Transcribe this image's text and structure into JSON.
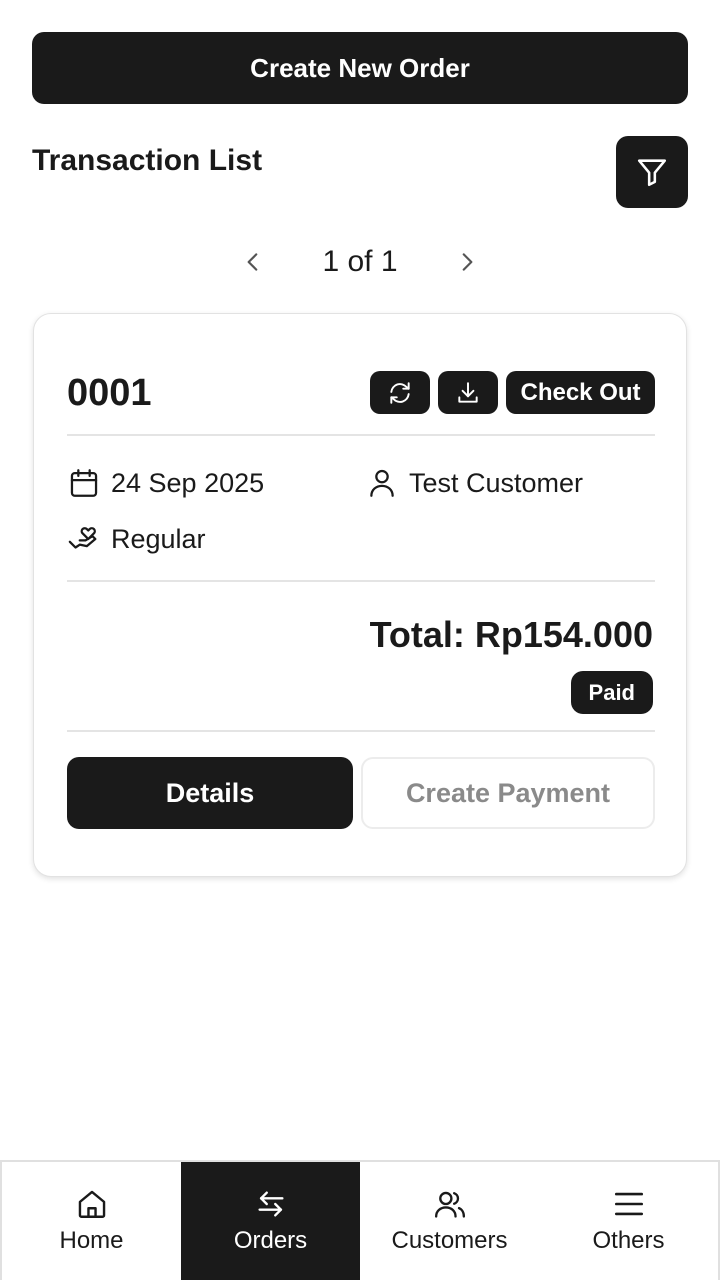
{
  "header": {
    "create_order_label": "Create New Order",
    "section_title": "Transaction List",
    "filter_icon": "filter-icon"
  },
  "pagination": {
    "label": "1 of 1",
    "prev_icon": "chevron-left-icon",
    "next_icon": "chevron-right-icon"
  },
  "order": {
    "id": "0001",
    "actions": {
      "refresh_icon": "refresh-icon",
      "download_icon": "download-icon",
      "checkout_label": "Check Out"
    },
    "date": "24 Sep 2025",
    "customer": "Test Customer",
    "service_type": "Regular",
    "total": "Total: Rp154.000",
    "status": "Paid",
    "details_label": "Details",
    "create_payment_label": "Create Payment"
  },
  "nav": {
    "items": [
      {
        "label": "Home",
        "icon": "home-icon"
      },
      {
        "label": "Orders",
        "icon": "swap-arrows-icon",
        "active": true
      },
      {
        "label": "Customers",
        "icon": "users-icon"
      },
      {
        "label": "Others",
        "icon": "menu-icon"
      }
    ]
  },
  "colors": {
    "primary": "#1a1a1a",
    "background": "#ffffff",
    "muted_text": "#8a8a8a",
    "border": "#e2e2e2"
  }
}
